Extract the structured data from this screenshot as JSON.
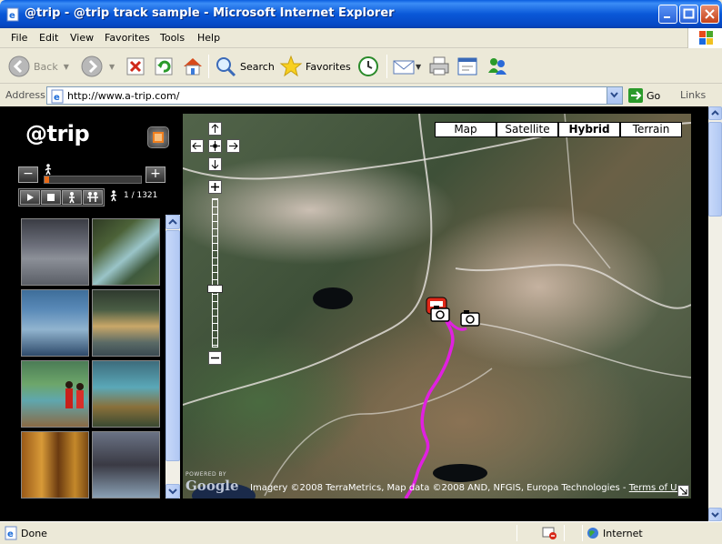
{
  "window": {
    "title": "@trip - @trip track sample - Microsoft Internet Explorer"
  },
  "menu": {
    "items": [
      "File",
      "Edit",
      "View",
      "Favorites",
      "Tools",
      "Help"
    ]
  },
  "toolbar": {
    "back_label": "Back",
    "search_label": "Search",
    "favorites_label": "Favorites",
    "icons": [
      "back-icon",
      "forward-icon",
      "stop-icon",
      "refresh-icon",
      "home-icon",
      "search-icon",
      "favorites-icon",
      "history-icon",
      "mail-icon",
      "print-icon",
      "edit-icon",
      "messenger-icon"
    ]
  },
  "address": {
    "label": "Address",
    "url": "http://www.a-trip.com/",
    "go_label": "Go",
    "links_label": "Links"
  },
  "app": {
    "logo": "@trip",
    "zoom_out": "−",
    "zoom_in": "+",
    "speed_fraction": 0.05,
    "track_counter": "1 / 1321",
    "playback_controls": [
      "play",
      "stop",
      "walk",
      "group"
    ],
    "photos": [
      "misty-lake",
      "river-valley",
      "blue-lake-mist",
      "lakeside-reflection",
      "couple-at-lake",
      "turquoise-river",
      "autumn-forest",
      "misty-mountains"
    ]
  },
  "map": {
    "types": [
      "Map",
      "Satellite",
      "Hybrid",
      "Terrain"
    ],
    "selected_type": "Hybrid",
    "zoom_level_fraction": 0.58,
    "attribution": "Imagery ©2008 TerraMetrics, Map data ©2008 AND, NFGIS, Europa Technologies -",
    "terms_link": "Terms of Use",
    "powered_by": "POWERED BY",
    "google": "Google",
    "track_color": "#e020e0"
  },
  "status": {
    "text": "Done",
    "zone": "Internet"
  }
}
